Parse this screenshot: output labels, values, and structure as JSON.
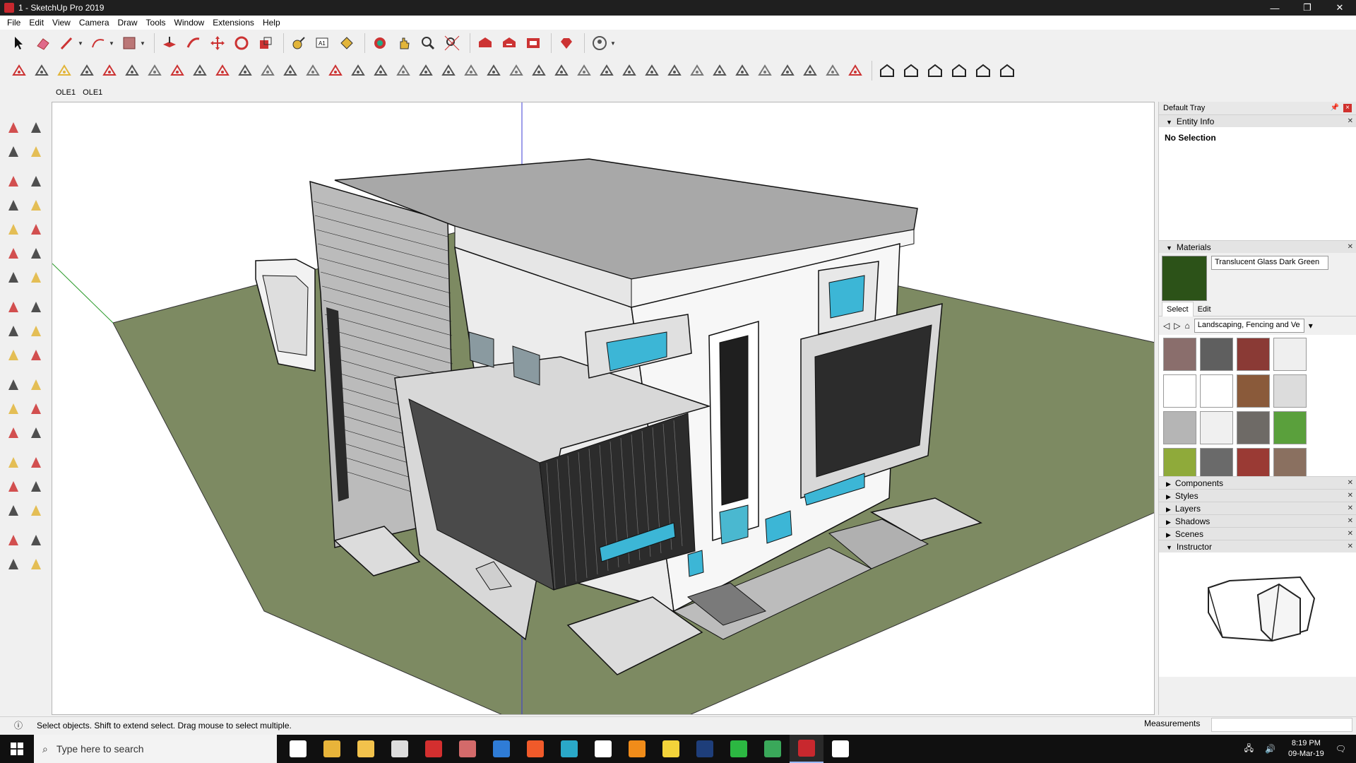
{
  "window": {
    "title": "1 - SketchUp Pro 2019",
    "minimize": "—",
    "restore": "❐",
    "close": "✕"
  },
  "menu": [
    "File",
    "Edit",
    "View",
    "Camera",
    "Draw",
    "Tools",
    "Window",
    "Extensions",
    "Help"
  ],
  "scene_tabs": [
    "OLE1",
    "OLE1"
  ],
  "tray": {
    "title": "Default Tray",
    "entity_info": {
      "title": "Entity Info",
      "selection": "No Selection"
    },
    "materials": {
      "title": "Materials",
      "current": "Translucent Glass Dark Green",
      "current_color": "#2c5218",
      "tabs": [
        "Select",
        "Edit"
      ],
      "library": "Landscaping, Fencing and Ve",
      "swatches": [
        "#8a6e6c",
        "#5f5f5f",
        "#8a3a35",
        "#efefef",
        "#ffffff",
        "#ffffff",
        "#8a5a3a",
        "#dcdcdc",
        "#b5b5b5",
        "#f0f0f0",
        "#6e6a66",
        "#5aa03c",
        "#8faa3a",
        "#6a6a6a",
        "#9a3a34",
        "#8a7060"
      ]
    },
    "collapsed_panels": [
      "Components",
      "Styles",
      "Layers",
      "Shadows",
      "Scenes"
    ],
    "instructor": {
      "title": "Instructor"
    }
  },
  "status": {
    "text": "Select objects. Shift to extend select. Drag mouse to select multiple.",
    "measurements_label": "Measurements"
  },
  "taskbar": {
    "search_placeholder": "Type here to search",
    "time": "8:19 PM",
    "date": "09-Mar-19"
  }
}
